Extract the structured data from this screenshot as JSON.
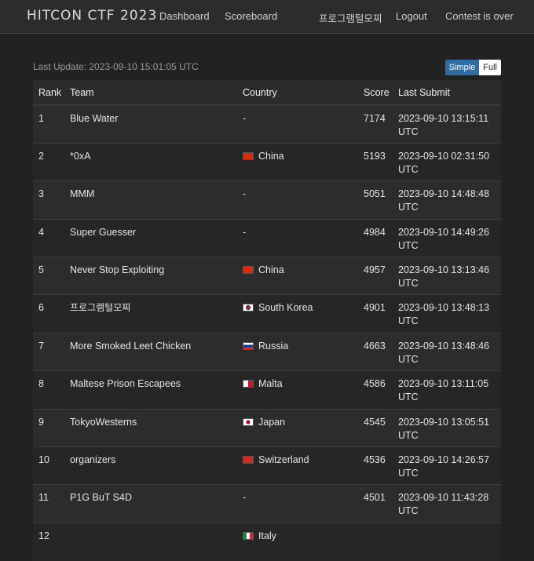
{
  "nav": {
    "brand": "HITCON CTF 2023",
    "dashboard": "Dashboard",
    "scoreboard": "Scoreboard",
    "user": "프로그램털모찌",
    "logout": "Logout",
    "status": "Contest is over"
  },
  "last_update": "Last Update: 2023-09-10 15:01:05 UTC",
  "view_toggle": {
    "simple": "Simple",
    "full": "Full",
    "selected": "Simple"
  },
  "table": {
    "headers": {
      "rank": "Rank",
      "team": "Team",
      "country": "Country",
      "score": "Score",
      "last_submit": "Last Submit"
    },
    "rows": [
      {
        "rank": "1",
        "team": "Blue Water",
        "country": "-",
        "flag": "",
        "score": "7174",
        "last_submit": "2023-09-10 13:15:11 UTC"
      },
      {
        "rank": "2",
        "team": "*0xA",
        "country": "China",
        "flag": "china",
        "score": "5193",
        "last_submit": "2023-09-10 02:31:50 UTC"
      },
      {
        "rank": "3",
        "team": "MMM",
        "country": "-",
        "flag": "",
        "score": "5051",
        "last_submit": "2023-09-10 14:48:48 UTC"
      },
      {
        "rank": "4",
        "team": "Super Guesser",
        "country": "-",
        "flag": "",
        "score": "4984",
        "last_submit": "2023-09-10 14:49:26 UTC"
      },
      {
        "rank": "5",
        "team": "Never Stop Exploiting",
        "country": "China",
        "flag": "china",
        "score": "4957",
        "last_submit": "2023-09-10 13:13:46 UTC"
      },
      {
        "rank": "6",
        "team": "프로그램털모찌",
        "country": "South Korea",
        "flag": "south-korea",
        "score": "4901",
        "last_submit": "2023-09-10 13:48:13 UTC"
      },
      {
        "rank": "7",
        "team": "More Smoked Leet Chicken",
        "country": "Russia",
        "flag": "russia",
        "score": "4663",
        "last_submit": "2023-09-10 13:48:46 UTC"
      },
      {
        "rank": "8",
        "team": "Maltese Prison Escapees",
        "country": "Malta",
        "flag": "malta",
        "score": "4586",
        "last_submit": "2023-09-10 13:11:05 UTC"
      },
      {
        "rank": "9",
        "team": "TokyoWesterns",
        "country": "Japan",
        "flag": "japan",
        "score": "4545",
        "last_submit": "2023-09-10 13:05:51 UTC"
      },
      {
        "rank": "10",
        "team": "organizers",
        "country": "Switzerland",
        "flag": "switzerland",
        "score": "4536",
        "last_submit": "2023-09-10 14:26:57 UTC"
      },
      {
        "rank": "11",
        "team": "P1G BuT S4D",
        "country": "-",
        "flag": "",
        "score": "4501",
        "last_submit": "2023-09-10 11:43:28 UTC"
      },
      {
        "rank": "12",
        "team": "",
        "country": "Italy",
        "flag": "italy",
        "score": "",
        "last_submit": ""
      }
    ]
  },
  "colors": {
    "background": "#222222",
    "navbar": "#2c2c2c",
    "toggle_active": "#2e6da4"
  }
}
